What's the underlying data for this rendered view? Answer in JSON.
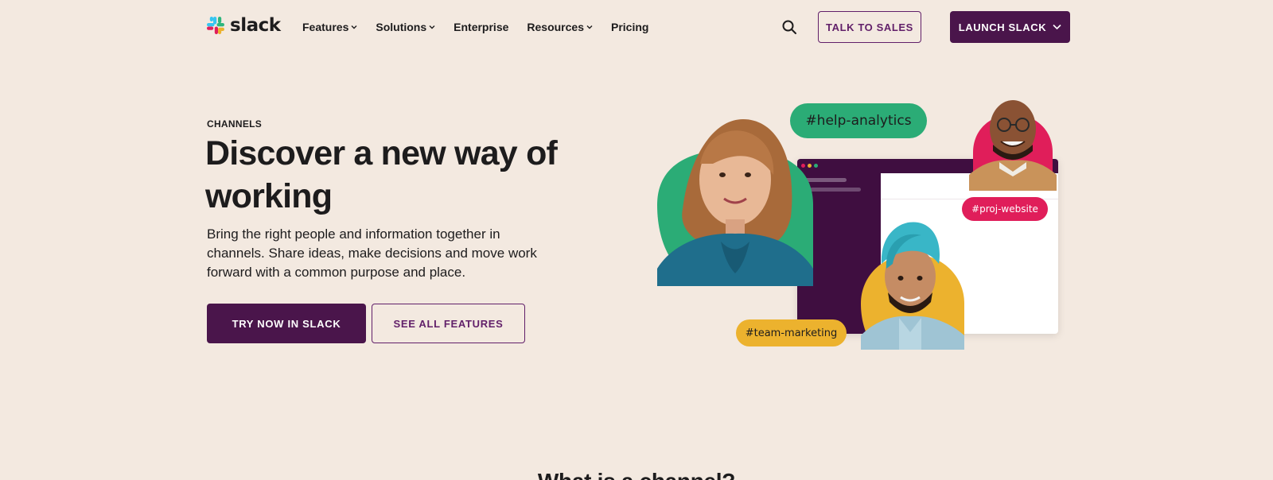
{
  "brand": {
    "name": "slack"
  },
  "nav": {
    "items": [
      {
        "label": "Features",
        "has_dropdown": true
      },
      {
        "label": "Solutions",
        "has_dropdown": true
      },
      {
        "label": "Enterprise",
        "has_dropdown": false
      },
      {
        "label": "Resources",
        "has_dropdown": true
      },
      {
        "label": "Pricing",
        "has_dropdown": false
      }
    ],
    "search_icon": "search-icon",
    "talk_to_sales": "TALK TO SALES",
    "launch_slack": "LAUNCH SLACK"
  },
  "hero": {
    "eyebrow": "CHANNELS",
    "headline": "Discover a new way of working",
    "subtext": "Bring the right people and information together in channels. Share ideas, make decisions and move work forward with a common purpose and place.",
    "primary_button": "TRY NOW IN SLACK",
    "secondary_button": "SEE ALL FEATURES"
  },
  "illustration": {
    "tags": {
      "help": "#help-analytics",
      "proj": "#proj-website",
      "team": "#team-marketing"
    }
  },
  "next_section": {
    "title": "What is a channel?"
  },
  "colors": {
    "background": "#f3e9e0",
    "aubergine": "#4a154b",
    "aubergine_border": "#611f69",
    "green": "#2bac76",
    "red": "#e01e5a",
    "yellow": "#ecb22e",
    "blue": "#36c5f0"
  }
}
